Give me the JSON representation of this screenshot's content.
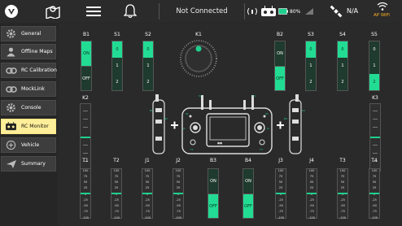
{
  "toolbar": {
    "status": "Not Connected",
    "battery_percent": "80%",
    "gps_status": "N/A",
    "wifi_label": "AP WiFi"
  },
  "sidebar": {
    "items": [
      {
        "label": "General",
        "icon": "gear-icon",
        "active": false
      },
      {
        "label": "Offline Maps",
        "icon": "user-icon",
        "active": false
      },
      {
        "label": "RC Calibration",
        "icon": "link-icon",
        "active": false
      },
      {
        "label": "MockLink",
        "icon": "link-icon",
        "active": false
      },
      {
        "label": "Console",
        "icon": "gear-icon",
        "active": false
      },
      {
        "label": "RC Monitor",
        "icon": "rc-icon",
        "active": true
      },
      {
        "label": "Vehicle",
        "icon": "vehicle-icon",
        "active": false
      },
      {
        "label": "Summary",
        "icon": "plane-icon",
        "active": false
      }
    ]
  },
  "monitor": {
    "knob_label": "K1",
    "switches_top": [
      {
        "label": "B1",
        "type": "onoff",
        "states": [
          "ON",
          "OFF"
        ],
        "active": "ON"
      },
      {
        "label": "S1",
        "type": "three",
        "states": [
          "0",
          "1",
          "2"
        ],
        "active": "0"
      },
      {
        "label": "S2",
        "type": "three",
        "states": [
          "0",
          "1",
          "2"
        ],
        "active": "0"
      },
      {
        "label": "B2",
        "type": "onoff",
        "states": [
          "ON",
          "OFF"
        ],
        "active": "OFF"
      },
      {
        "label": "S3",
        "type": "three",
        "states": [
          "0",
          "1",
          "2"
        ],
        "active": "0"
      },
      {
        "label": "S4",
        "type": "three",
        "states": [
          "0",
          "1",
          "2"
        ],
        "active": "0"
      },
      {
        "label": "S5",
        "type": "three",
        "states": [
          "0",
          "1",
          "2"
        ],
        "active": "2"
      }
    ],
    "k2_label": "K2",
    "k3_label": "K3",
    "bottom_channels": [
      {
        "label": "T1",
        "type": "slider"
      },
      {
        "label": "T2",
        "type": "slider"
      },
      {
        "label": "J1",
        "type": "slider"
      },
      {
        "label": "J2",
        "type": "slider"
      },
      {
        "label": "B3",
        "type": "onoff",
        "states": [
          "ON",
          "OFF"
        ],
        "active": "OFF"
      },
      {
        "label": "B4",
        "type": "onoff",
        "states": [
          "ON",
          "OFF"
        ],
        "active": "OFF"
      },
      {
        "label": "J3",
        "type": "slider"
      },
      {
        "label": "J4",
        "type": "slider"
      },
      {
        "label": "T3",
        "type": "slider"
      },
      {
        "label": "T4",
        "type": "slider"
      }
    ],
    "slider_ticks": [
      "100",
      "75",
      "50",
      "25",
      "0",
      "-25",
      "-50",
      "-75",
      "-100"
    ],
    "colors": {
      "accent": "#1ED08E",
      "active_sidebar": "#FFEE99",
      "background": "#282828"
    }
  }
}
